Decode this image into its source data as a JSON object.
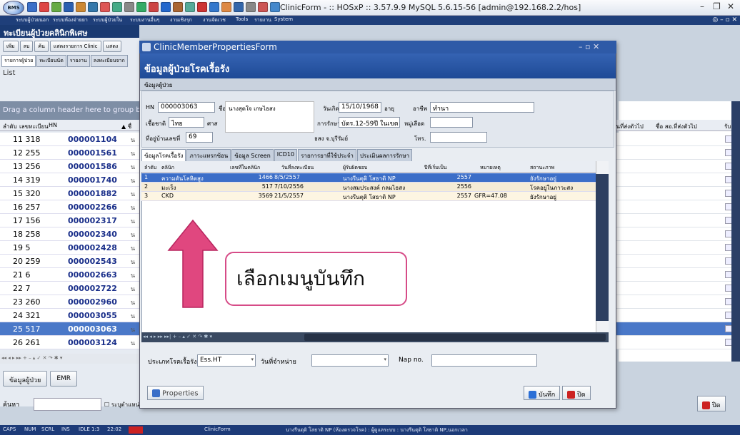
{
  "app": {
    "logo_text": "BMS",
    "window_title": "ClinicForm - :: HOSxP :: 3.57.9.9 MySQL 5.6.15-56 [admin@192.168.2.2/hos]",
    "min_glyph": "–",
    "max_glyph": "❐",
    "close_glyph": "✕",
    "toolbar_icon_colors": [
      "#3a6fc8",
      "#d44",
      "#6a4",
      "#2a5fb0",
      "#c83",
      "#37a",
      "#d55",
      "#4a8",
      "#888",
      "#3a6",
      "#c44",
      "#2266cc",
      "#a63",
      "#5a9",
      "#c33",
      "#37c",
      "#d84",
      "#36a",
      "#888",
      "#c55",
      "#48c"
    ]
  },
  "menu": {
    "items": [
      "ระบบผู้ป่วยนอก",
      "ระบบห้องจ่ายยา",
      "ระบบผู้ป่วยใน",
      "ระบบงานอื่นๆ",
      "งานเชิงรุก",
      "งานจัดเวช",
      "Tools",
      "รายงาน",
      "System"
    ],
    "mdi_controls": "◎ – ▫ ✕"
  },
  "left_panel": {
    "title": "ทะเบียนผู้ป่วยคลินิกพิเศษ",
    "toolbar": [
      "เพิ่ม",
      "ลบ",
      "ค้น",
      "แสดงรายการ Clinic",
      "แสดง"
    ],
    "tabs": [
      "รายการผู้ป่วย",
      "ทะเบียนนัด",
      "รายงาน",
      "ลงทะเบียนจาก"
    ],
    "list_label": "List",
    "group_hint": "Drag a column header here to group by",
    "col_order": "ลำดับ",
    "col_reg": "เลขทะเบียน",
    "col_hn": "HN",
    "col_sort": "▲ ชื่",
    "rows": [
      {
        "n": "11",
        "reg": "318",
        "hn": "000001104",
        "x": "น"
      },
      {
        "n": "12",
        "reg": "255",
        "hn": "000001561",
        "x": "น"
      },
      {
        "n": "13",
        "reg": "256",
        "hn": "000001586",
        "x": "น"
      },
      {
        "n": "14",
        "reg": "319",
        "hn": "000001740",
        "x": "น"
      },
      {
        "n": "15",
        "reg": "320",
        "hn": "000001882",
        "x": "น"
      },
      {
        "n": "16",
        "reg": "257",
        "hn": "000002266",
        "x": "น"
      },
      {
        "n": "17",
        "reg": "156",
        "hn": "000002317",
        "x": "น"
      },
      {
        "n": "18",
        "reg": "258",
        "hn": "000002340",
        "x": "น"
      },
      {
        "n": "19",
        "reg": "5",
        "hn": "000002428",
        "x": "น"
      },
      {
        "n": "20",
        "reg": "259",
        "hn": "000002543",
        "x": "น"
      },
      {
        "n": "21",
        "reg": "6",
        "hn": "000002663",
        "x": "น"
      },
      {
        "n": "22",
        "reg": "7",
        "hn": "000002722",
        "x": "น"
      },
      {
        "n": "23",
        "reg": "260",
        "hn": "000002960",
        "x": "น"
      },
      {
        "n": "24",
        "reg": "321",
        "hn": "000003055",
        "x": "น"
      },
      {
        "n": "25",
        "reg": "517",
        "hn": "000003063",
        "x": "น"
      },
      {
        "n": "26",
        "reg": "261",
        "hn": "000003124",
        "x": "น"
      }
    ],
    "selected_row_index": 14,
    "nav": "◂◂ ◂ ▸ ▸▸ + – ▴ ✓ ✕ ↷ ✱ ▾",
    "btn_patient_info": "ข้อมูลผู้ป่วย",
    "btn_emr": "EMR",
    "search_label": "ค้นหา",
    "search_option": "ระบุตำแหน่ง"
  },
  "right_grid": {
    "col_last_date": "วันที่ส่งตัวไป",
    "col_last_place": "ชื่อ สอ.ที่ส่งตัวไป",
    "col_x": "รับ"
  },
  "close_button": "ปิด",
  "status": {
    "caps": "CAPS",
    "num": "NUM",
    "scrl": "SCRL",
    "ins": "INS",
    "idle": "IDLE 1:3",
    "time": "22:02",
    "form": "ClinicForm",
    "user": "นางรีนตุติ โสธาติ NP (ห้องตรวจโรค) : ผู้ดูแลระบบ : นางรีนตุติ โสธาติ NP,นอกเวลา"
  },
  "dialog": {
    "title": "ClinicMemberPropertiesForm",
    "controls": "– ▫ ✕",
    "header": "ข้อมูลผู้ป่วยโรคเรื้อรัง",
    "sub": "ข้อมูลผู้ป่วย",
    "hn_label": "HN",
    "hn_value": "000003063",
    "name_label": "ชื่อ",
    "name_value": "นางสุดใจ เกษไธสง",
    "dob_label": "วันเกิด",
    "dob_value": "15/10/1968",
    "age_label": "อายุ",
    "job_label": "อาชีพ",
    "job_value": "ทำนา",
    "nation_label": "เชื้อชาติ",
    "nation_value": "ไทย",
    "religion_label": "ศาส",
    "pttype_label": "การรักษา",
    "pttype_value": "บัตร.12-59ปี ในเขต",
    "village_label": "หมู่เลือด",
    "addr_label": "ที่อยู่บ้านเลขที่",
    "addr_value": "69",
    "addr_rest": "ธสง จ.บุรีรัมย์",
    "tel_label": "โทร.",
    "tabs": [
      "ข้อมูลโรคเรื้อรัง",
      "ภาวะแทรกซ้อน",
      "ข้อมูล Screen",
      "ICD10",
      "รายการยาที่ใช้ประจำ",
      "ประเมินผลการรักษา"
    ],
    "grid_cols": [
      "ลำดับ",
      "คลินิก",
      "เลขที่ในคลินิก",
      "วันที่ลงทะเบียน",
      "ผู้รับผิดชอบ",
      "ปีที่เริ่มเป็น",
      "หมายเหตุ",
      "สถานะภาพ"
    ],
    "grid_rows": [
      {
        "n": "1",
        "clinic": "ความดันโลหิตสูง",
        "no": "1466",
        "date": "8/5/2557",
        "staff": "นางรีนตุติ โสธาติ NP",
        "year": "2557",
        "note": "",
        "status": "ยังรักษาอยู่"
      },
      {
        "n": "2",
        "clinic": "มะเร็ง",
        "no": "517",
        "date": "7/10/2556",
        "staff": "นางสมประสงค์ กลมไธสง",
        "year": "2556",
        "note": "",
        "status": "โรคอยู่ในภาวะสง"
      },
      {
        "n": "3",
        "clinic": "CKD",
        "no": "3569",
        "date": "21/5/2557",
        "staff": "นางรีนตุติ โสธาติ NP",
        "year": "2557",
        "note": "GFR=47.08",
        "status": "ยังรักษาอยู่"
      }
    ],
    "inav": "◂◂ ◂ ▸ ▸▸ ▸▸| + – ▴ ✓ ✕ ↷ ✱ ▾",
    "type_label": "ประเภทโรคเรื้อรัง",
    "type_value": "Ess.HT",
    "discharge_label": "วันที่จำหน่าย",
    "discharge_value": "",
    "nap_label": "Nap no.",
    "nap_value": "",
    "properties_btn": "Properties",
    "save_btn": "บันทึก",
    "close_btn": "ปิด"
  },
  "annotation": {
    "text": "เลือกเมนูบันทึก",
    "color": "#e0477f"
  }
}
